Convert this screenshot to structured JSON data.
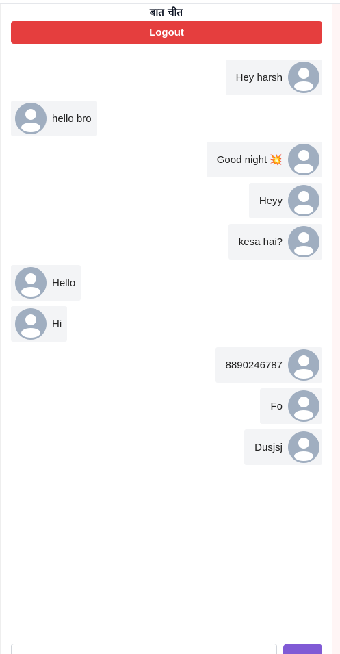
{
  "header": {
    "title": "बात चीत",
    "logout_label": "Logout",
    "logout_color": "#e53e3e"
  },
  "messages": [
    {
      "text": "Hey harsh",
      "direction": "sent"
    },
    {
      "text": "hello bro",
      "direction": "received"
    },
    {
      "text": "Good night 💥",
      "direction": "sent"
    },
    {
      "text": "Heyy",
      "direction": "sent"
    },
    {
      "text": "kesa hai?",
      "direction": "sent"
    },
    {
      "text": "Hello",
      "direction": "received"
    },
    {
      "text": "Hi",
      "direction": "received"
    },
    {
      "text": "8890246787",
      "direction": "sent"
    },
    {
      "text": "Fo",
      "direction": "sent"
    },
    {
      "text": "Dusjsj",
      "direction": "sent"
    }
  ],
  "composer": {
    "input_value": "",
    "send_icon": "send-icon",
    "send_color": "#805ad5"
  },
  "icons": {
    "avatar": "user-avatar-icon"
  },
  "colors": {
    "bubble_bg": "#f3f4f6",
    "avatar_fill": "#a0aec0"
  }
}
